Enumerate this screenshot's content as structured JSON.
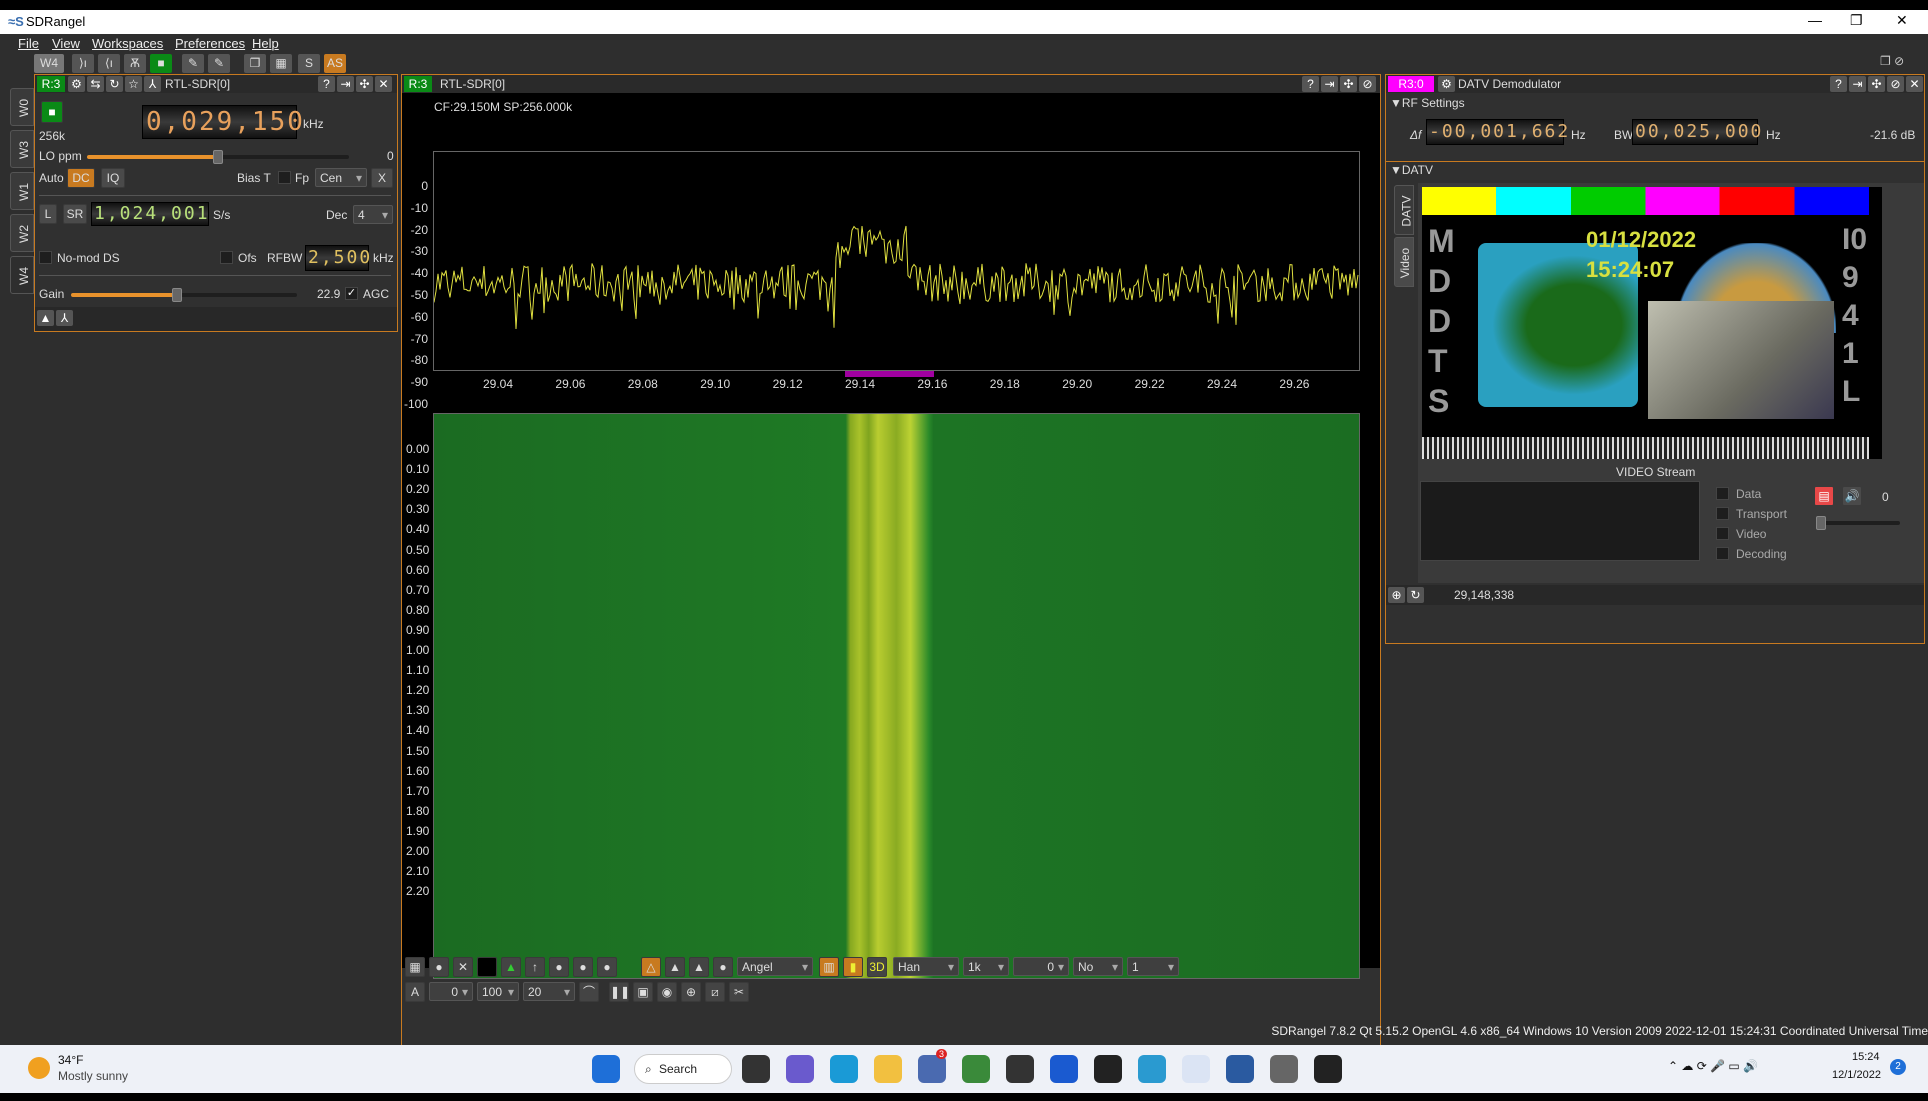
{
  "window": {
    "title": "SDRangel",
    "minimize": "—",
    "maximize": "❐",
    "close": "✕"
  },
  "menu": [
    "File",
    "View",
    "Workspaces",
    "Preferences",
    "Help"
  ],
  "toolbar": {
    "workspace": "W4",
    "s": "S",
    "as": "AS"
  },
  "workspace_tabs": [
    "W0",
    "W3",
    "W1",
    "W2",
    "W4"
  ],
  "device_panel": {
    "badge": "R:3",
    "title": "RTL-SDR[0]",
    "sample_rate_label": "256k",
    "center_freq": "0,029,150",
    "freq_unit": "kHz",
    "lo_ppm_label": "LO ppm",
    "lo_ppm_value": "0",
    "lo_ppm_level": 0.5,
    "auto_label": "Auto",
    "dc": "DC",
    "iq": "IQ",
    "bias_t": "Bias T",
    "fp": "Fp",
    "fp_value": "Cen",
    "x": "X",
    "l": "L",
    "sr": "SR",
    "sample_rate": "1,024,001",
    "sr_unit": "S/s",
    "dec_label": "Dec",
    "dec_value": "4",
    "nomod": "No-mod DS",
    "ofs": "Ofs",
    "rfbw_label": "RFBW",
    "rfbw": "2,500",
    "rfbw_unit": "kHz",
    "gain_label": "Gain",
    "gain_value": "22.9",
    "gain_level": 0.47,
    "agc": "AGC",
    "agc_checked": true
  },
  "spectrum_panel": {
    "badge": "R:3",
    "title": "RTL-SDR[0]",
    "info": "CF:29.150M SP:256.000k",
    "y_ticks": [
      "0",
      "-10",
      "-20",
      "-30",
      "-40",
      "-50",
      "-60",
      "-70",
      "-80",
      "-90",
      "-100"
    ],
    "x_ticks": [
      "29.04",
      "29.06",
      "29.08",
      "29.10",
      "29.12",
      "29.14",
      "29.16",
      "29.18",
      "29.20",
      "29.22",
      "29.24",
      "29.26"
    ],
    "wf_ticks": [
      "0.00",
      "0.10",
      "0.20",
      "0.30",
      "0.40",
      "0.50",
      "0.60",
      "0.70",
      "0.80",
      "0.90",
      "1.00",
      "1.10",
      "1.20",
      "1.30",
      "1.40",
      "1.50",
      "1.60",
      "1.70",
      "1.80",
      "1.90",
      "2.00",
      "2.10",
      "2.20"
    ],
    "palette": "Angel",
    "window": "Han",
    "fft": "1k",
    "offset": "0",
    "avg": "No",
    "avg_n": "1",
    "a": "A",
    "ref": "0",
    "range": "100",
    "fps": "20",
    "trace_color": "#e0e040",
    "channel_marker_color": "#a000a0"
  },
  "datv_panel": {
    "badge": "R3:0",
    "title": "DATV Demodulator",
    "rf_settings": "RF Settings",
    "df_label": "Δf",
    "df": "-00,001,662",
    "df_unit": "Hz",
    "bw_label": "BW",
    "bw": "00,025,000",
    "bw_unit": "Hz",
    "power": "-21.6 dB",
    "datv_section": "DATV",
    "tabs": [
      "DATV",
      "Video"
    ],
    "video_date": "01/12/2022",
    "video_time": "15:24:07",
    "left_text": "MDDTS",
    "right_text": "I0941L",
    "video_stream": "VIDEO Stream",
    "checks": [
      "Data",
      "Transport",
      "Video",
      "Decoding"
    ],
    "volume_value": "0",
    "freq": "29,148,338",
    "badge_color": "#ff00ff"
  },
  "statusbar": "SDRangel 7.8.2 Qt 5.15.2 OpenGL 4.6 x86_64 Windows 10 Version 2009  2022-12-01 15:24:31 Coordinated Universal Time",
  "taskbar": {
    "temp": "34°F",
    "weather": "Mostly sunny",
    "search": "Search",
    "time": "15:24",
    "date": "12/1/2022",
    "notifications": "2",
    "badge": "3"
  }
}
